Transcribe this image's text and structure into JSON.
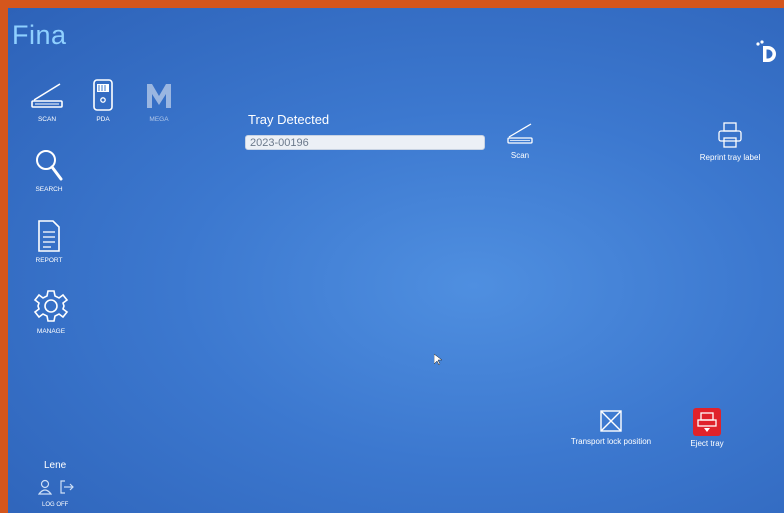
{
  "app": {
    "name": "Fina"
  },
  "sidebar": {
    "items": [
      {
        "label": "SCAN",
        "icon": "scanner-icon"
      },
      {
        "label": "PDA",
        "icon": "pda-device-icon"
      },
      {
        "label": "MEGA",
        "icon": "mega-m-icon"
      },
      {
        "label": "SEARCH",
        "icon": "magnifier-icon"
      },
      {
        "label": "REPORT",
        "icon": "document-icon"
      },
      {
        "label": "MANAGE",
        "icon": "gear-icon"
      }
    ]
  },
  "main": {
    "title": "Tray Detected",
    "tray_id": "2023-00196"
  },
  "actions": {
    "scan": "Scan",
    "reprint": "Reprint tray label",
    "transport_lock": "Transport lock position",
    "eject": "Eject tray"
  },
  "user": {
    "name": "Lene",
    "logoff_label": "LOG OFF"
  },
  "colors": {
    "background": "#3c78cf",
    "eject_button": "#e0222b",
    "logo": "#8fd0ff"
  }
}
